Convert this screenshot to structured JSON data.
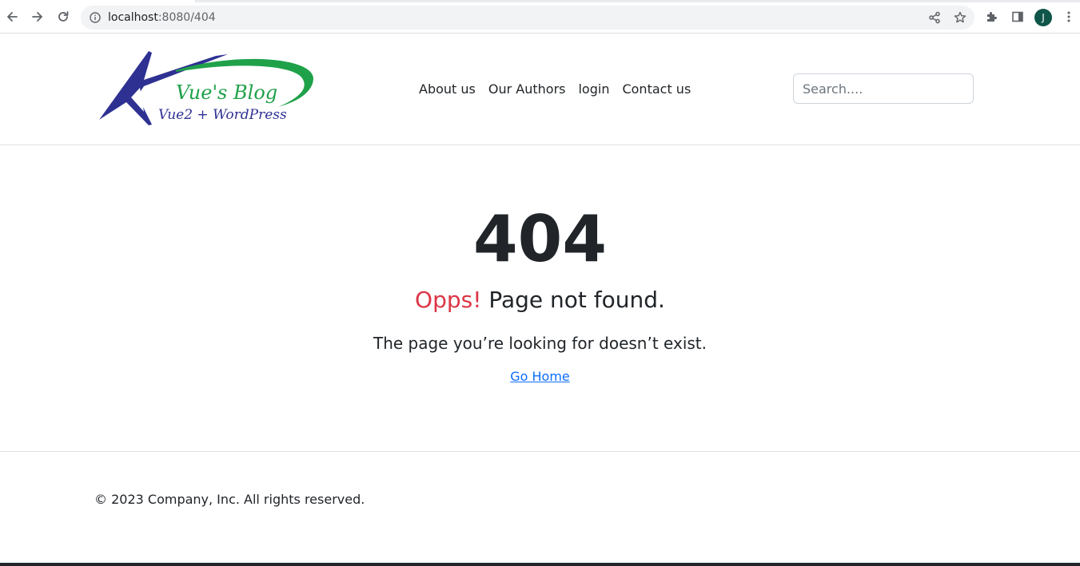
{
  "browser": {
    "url_host": "localhost",
    "url_path": ":8080/404",
    "profile_initial": "J",
    "icons": [
      "back-icon",
      "forward-icon",
      "reload-icon",
      "info-icon",
      "share-icon",
      "star-icon",
      "extensions-icon",
      "side-panel-icon",
      "menu-icon"
    ]
  },
  "header": {
    "logo": {
      "title": "Vue's Blog",
      "subtitle": "Vue2 + WordPress"
    },
    "nav": [
      {
        "label": "About us"
      },
      {
        "label": "Our Authors"
      },
      {
        "label": "login"
      },
      {
        "label": "Contact us"
      }
    ],
    "search": {
      "placeholder": "Search....",
      "value": ""
    }
  },
  "main": {
    "code": "404",
    "headline_accent": "Opps!",
    "headline_rest": "Page not found.",
    "description": "The page you’re looking for doesn’t exist.",
    "home_link": "Go Home"
  },
  "footer": {
    "copyright": "© 2023 Company, Inc. All rights reserved."
  },
  "colors": {
    "accent": "#dc3545",
    "link": "#0d6efd",
    "text": "#212529",
    "logo_blue": "#2e3192",
    "logo_green": "#1fa14a",
    "avatar_bg": "#0f5549"
  }
}
